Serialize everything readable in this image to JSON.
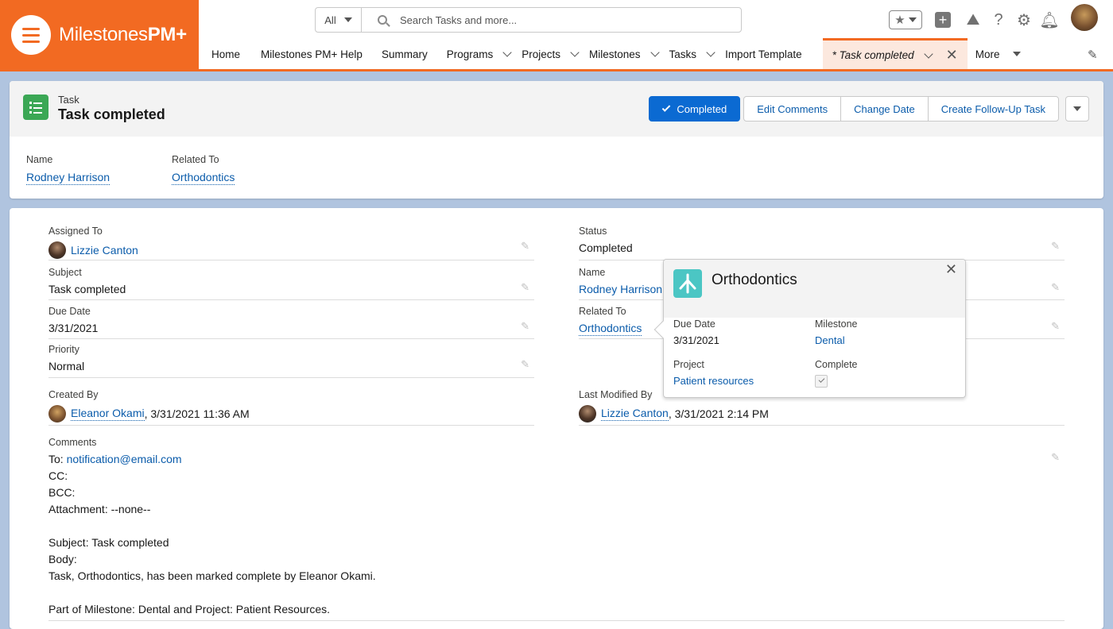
{
  "app": {
    "brand_prefix": "Milestones",
    "brand_suffix": "PM+"
  },
  "search": {
    "scope": "All",
    "placeholder": "Search Tasks and more..."
  },
  "nav": {
    "items": [
      {
        "label": "Home"
      },
      {
        "label": "Milestones PM+ Help"
      },
      {
        "label": "Summary"
      },
      {
        "label": "Programs"
      },
      {
        "label": "Projects"
      },
      {
        "label": "Milestones"
      },
      {
        "label": "Tasks"
      },
      {
        "label": "Import Template"
      }
    ],
    "active_tab": "* Task completed",
    "more": "More"
  },
  "record": {
    "object_type": "Task",
    "title": "Task completed",
    "actions": {
      "completed": "Completed",
      "edit_comments": "Edit Comments",
      "change_date": "Change Date",
      "follow_up": "Create Follow-Up Task"
    },
    "highlights": {
      "name_label": "Name",
      "name_value": "Rodney Harrison",
      "related_label": "Related To",
      "related_value": "Orthodontics"
    }
  },
  "details": {
    "assigned_to": {
      "label": "Assigned To",
      "value": "Lizzie Canton"
    },
    "subject": {
      "label": "Subject",
      "value": "Task completed"
    },
    "due_date": {
      "label": "Due Date",
      "value": "3/31/2021"
    },
    "priority": {
      "label": "Priority",
      "value": "Normal"
    },
    "created_by": {
      "label": "Created By",
      "user": "Eleanor Okami",
      "stamp": ", 3/31/2021 11:36 AM"
    },
    "status": {
      "label": "Status",
      "value": "Completed"
    },
    "name": {
      "label": "Name",
      "value": "Rodney Harrison"
    },
    "related_to": {
      "label": "Related To",
      "value": "Orthodontics"
    },
    "last_modified": {
      "label": "Last Modified By",
      "user": "Lizzie Canton",
      "stamp": ", 3/31/2021 2:14 PM"
    },
    "comments": {
      "label": "Comments",
      "to_prefix": "To: ",
      "to_email": "notification@email.com",
      "lines": [
        "CC:",
        "BCC:",
        "Attachment: --none--",
        "",
        "Subject: Task completed",
        "Body:",
        "Task, Orthodontics, has been marked complete by Eleanor Okami.",
        "",
        "Part of Milestone: Dental and Project: Patient Resources."
      ]
    }
  },
  "popover": {
    "title": "Orthodontics",
    "due_date_label": "Due Date",
    "due_date_value": "3/31/2021",
    "milestone_label": "Milestone",
    "milestone_value": "Dental",
    "project_label": "Project",
    "project_value": "Patient resources",
    "complete_label": "Complete",
    "complete_checked": true
  },
  "colors": {
    "brand": "#f26a22",
    "primary": "#0b6ad2",
    "link": "#0b5cab",
    "task_icon": "#3ba755",
    "milestone_icon": "#4bc6c4"
  }
}
